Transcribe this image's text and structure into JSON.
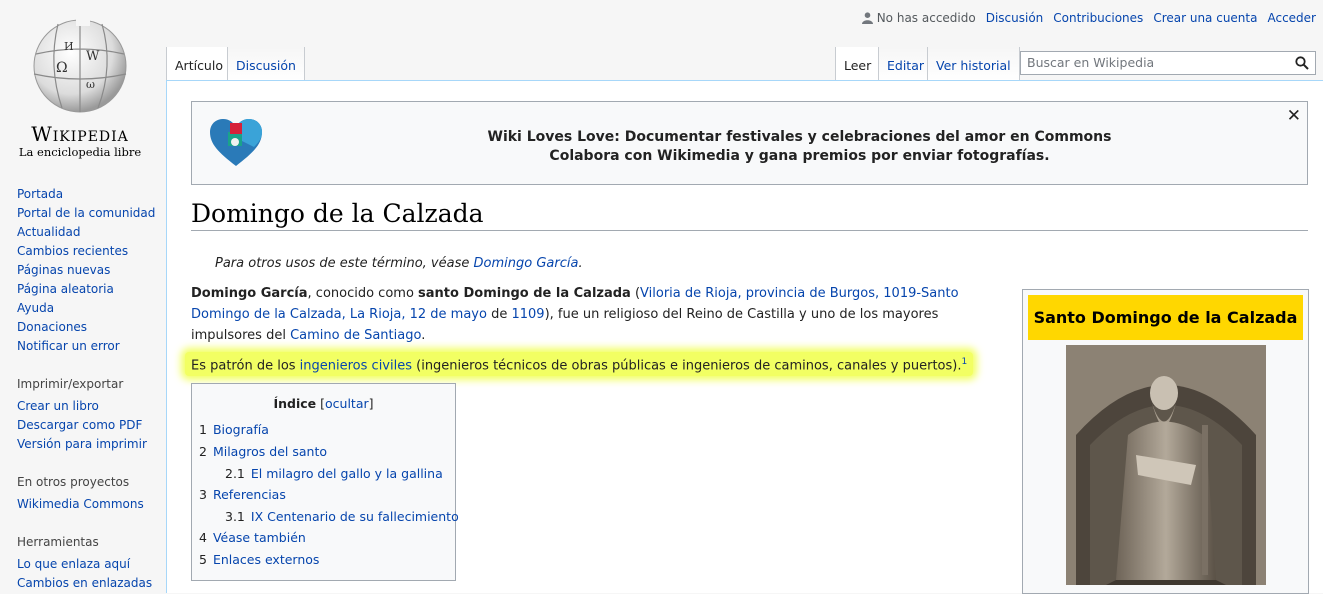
{
  "personal": {
    "not_logged": "No has accedido",
    "discussion": "Discusión",
    "contributions": "Contribuciones",
    "create_account": "Crear una cuenta",
    "login": "Acceder"
  },
  "logo": {
    "wordmark": "Wikipedia",
    "tagline": "La enciclopedia libre"
  },
  "sidebar": {
    "nav": [
      {
        "label": "Portada"
      },
      {
        "label": "Portal de la comunidad"
      },
      {
        "label": "Actualidad"
      },
      {
        "label": "Cambios recientes"
      },
      {
        "label": "Páginas nuevas"
      },
      {
        "label": "Página aleatoria"
      },
      {
        "label": "Ayuda"
      },
      {
        "label": "Donaciones"
      },
      {
        "label": "Notificar un error"
      }
    ],
    "print_heading": "Imprimir/exportar",
    "print": [
      {
        "label": "Crear un libro"
      },
      {
        "label": "Descargar como PDF"
      },
      {
        "label": "Versión para imprimir"
      }
    ],
    "projects_heading": "En otros proyectos",
    "projects": [
      {
        "label": "Wikimedia Commons"
      }
    ],
    "tools_heading": "Herramientas",
    "tools": [
      {
        "label": "Lo que enlaza aquí"
      },
      {
        "label": "Cambios en enlazadas"
      }
    ]
  },
  "tabs": {
    "article": "Artículo",
    "discussion": "Discusión",
    "read": "Leer",
    "edit": "Editar",
    "history": "Ver historial"
  },
  "search": {
    "placeholder": "Buscar en Wikipedia"
  },
  "banner": {
    "line1": "Wiki Loves Love: Documentar festivales y celebraciones del amor en Commons",
    "line2": "Colabora con Wikimedia y gana premios por enviar fotografías.",
    "close": "✕"
  },
  "article": {
    "title": "Domingo de la Calzada",
    "hatnote_prefix": "Para otros usos de este término, véase ",
    "hatnote_link": "Domingo García",
    "hatnote_suffix": ".",
    "p1": {
      "b1": "Domingo García",
      "t1": ", conocido como ",
      "b2": "santo Domingo de la Calzada",
      "t2": " (",
      "l1": "Viloria de Rioja, provincia de Burgos, 1019-Santo Domingo de la Calzada, La Rioja, 12 de mayo",
      "t3": " de ",
      "l2": "1109",
      "t4": "), fue un religioso del Reino de Castilla y uno de los mayores impulsores del ",
      "l3": "Camino de Santiago",
      "t5": "."
    },
    "p2": {
      "t1": "Es patrón de los ",
      "l1": "ingenieros civiles",
      "t2": " (ingenieros técnicos de obras públicas e ingenieros de caminos, canales y puertos).",
      "ref": "1"
    }
  },
  "toc": {
    "title": "Índice",
    "hide_open": "[",
    "hide": "ocultar",
    "hide_close": "]",
    "items": [
      {
        "num": "1",
        "label": "Biografía"
      },
      {
        "num": "2",
        "label": "Milagros del santo"
      },
      {
        "num": "2.1",
        "label": "El milagro del gallo y la gallina"
      },
      {
        "num": "3",
        "label": "Referencias"
      },
      {
        "num": "3.1",
        "label": "IX Centenario de su fallecimiento"
      },
      {
        "num": "4",
        "label": "Véase también"
      },
      {
        "num": "5",
        "label": "Enlaces externos"
      }
    ]
  },
  "infobox": {
    "title": "Santo Domingo de la Calzada"
  },
  "colors": {
    "link": "#0645ad",
    "highlight": "#f2ff63",
    "infobox_header": "#ffd700"
  }
}
